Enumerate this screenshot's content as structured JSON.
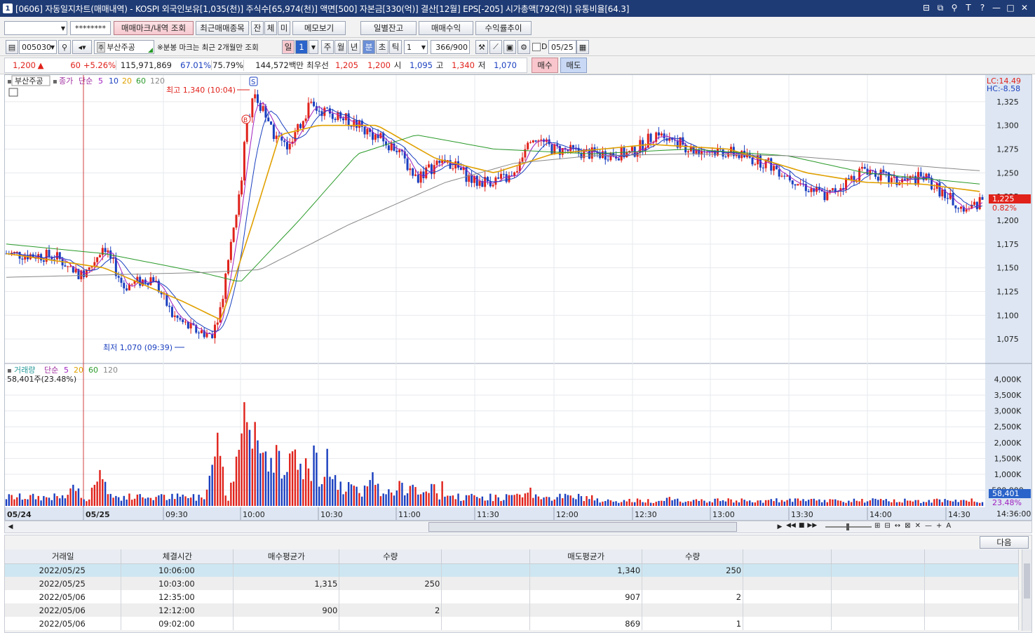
{
  "window": {
    "app_badge": "1",
    "title": "[0606] 자동일지차트(매매내역) - KOSPI 외국인보유[1,035(천)] 주식수[65,974(천)] 액면[500] 자본금[330(억)] 결산[12월] EPS[-205] 시가총액[792(억)] 유통비율[64.3]",
    "controls": [
      "⊟",
      "⧉",
      "⚲",
      "T",
      "?",
      "—",
      "□",
      "✕"
    ]
  },
  "toolbar1": {
    "account_value": "",
    "password_mask": "********",
    "buttons": [
      "매매마크/내역 조회",
      "최근매매종목",
      "잔",
      "체",
      "미",
      "메모보기"
    ],
    "buttons_right": [
      "일별잔고",
      "매매수익",
      "수익률추이"
    ]
  },
  "toolbar2": {
    "code": "005030",
    "stock_name": "부산주공",
    "note": "※분봉 마크는 최근 2개월만 조회",
    "period_tabs": [
      "일",
      "주",
      "월",
      "년",
      "분",
      "초",
      "틱"
    ],
    "day_count": "1",
    "interval": "1",
    "count_display": "366/900",
    "date_check_label": "D",
    "date": "05/25"
  },
  "quote": {
    "price": "1,200",
    "arrow": "▲",
    "change": "60",
    "change_pct": "+5.26%",
    "volume": "115,971,869",
    "rate1": "67.01%",
    "rate2": "75.79%",
    "amount": "144,572백만",
    "best_label": "최우선",
    "best_ask": "1,205",
    "best_bid": "1,200",
    "open_label": "시",
    "open": "1,095",
    "high_label": "고",
    "high": "1,340",
    "low_label": "저",
    "low": "1,070",
    "buy_label": "매수",
    "sell_label": "매도"
  },
  "chart_data": [
    {
      "type": "candlestick",
      "title": "부산주공",
      "legend": [
        "종가",
        "단순",
        "5",
        "10",
        "20",
        "60",
        "120"
      ],
      "legend_colors": {
        "close": "#a030a0",
        "ma5": "#a020c0",
        "ma10": "#1a3fbf",
        "ma20": "#e0a000",
        "ma60": "#2a9a2a",
        "ma120": "#888888"
      },
      "ylim": [
        1050,
        1350
      ],
      "y_ticks": [
        "1,325",
        "1,300",
        "1,275",
        "1,250",
        "1,225",
        "1,200",
        "1,175",
        "1,150",
        "1,125",
        "1,100",
        "1,075"
      ],
      "y_tick_values": [
        1325,
        1300,
        1275,
        1250,
        1225,
        1200,
        1175,
        1150,
        1125,
        1100,
        1075
      ],
      "x_ticks": [
        "05/24",
        "05/25",
        "09:30",
        "10:00",
        "10:30",
        "11:00",
        "11:30",
        "12:00",
        "12:30",
        "13:00",
        "13:30",
        "14:00",
        "14:30"
      ],
      "right_labels": {
        "lc": "LC:14.49",
        "hc": "HC:-8.58",
        "current": "1,225",
        "current_pct": "0.82%"
      },
      "annotations": {
        "high": "최고 1,340 (10:04)",
        "low": "최저 1,070 (09:39)",
        "sell_mark": "S",
        "buy_mark": "B"
      },
      "price_path": [
        {
          "t": 0,
          "v": 1165
        },
        {
          "t": 0.05,
          "v": 1162
        },
        {
          "t": 0.08,
          "v": 1140
        },
        {
          "t": 0.1,
          "v": 1175
        },
        {
          "t": 0.12,
          "v": 1130
        },
        {
          "t": 0.15,
          "v": 1140
        },
        {
          "t": 0.17,
          "v": 1100
        },
        {
          "t": 0.19,
          "v": 1085
        },
        {
          "t": 0.21,
          "v": 1080
        },
        {
          "t": 0.22,
          "v": 1110
        },
        {
          "t": 0.23,
          "v": 1180
        },
        {
          "t": 0.24,
          "v": 1230
        },
        {
          "t": 0.245,
          "v": 1300
        },
        {
          "t": 0.255,
          "v": 1335
        },
        {
          "t": 0.27,
          "v": 1295
        },
        {
          "t": 0.29,
          "v": 1275
        },
        {
          "t": 0.31,
          "v": 1320
        },
        {
          "t": 0.34,
          "v": 1310
        },
        {
          "t": 0.36,
          "v": 1300
        },
        {
          "t": 0.4,
          "v": 1275
        },
        {
          "t": 0.42,
          "v": 1245
        },
        {
          "t": 0.45,
          "v": 1265
        },
        {
          "t": 0.48,
          "v": 1240
        },
        {
          "t": 0.52,
          "v": 1245
        },
        {
          "t": 0.535,
          "v": 1290
        },
        {
          "t": 0.56,
          "v": 1275
        },
        {
          "t": 0.6,
          "v": 1270
        },
        {
          "t": 0.64,
          "v": 1270
        },
        {
          "t": 0.67,
          "v": 1295
        },
        {
          "t": 0.7,
          "v": 1275
        },
        {
          "t": 0.74,
          "v": 1272
        },
        {
          "t": 0.78,
          "v": 1260
        },
        {
          "t": 0.82,
          "v": 1235
        },
        {
          "t": 0.84,
          "v": 1225
        },
        {
          "t": 0.88,
          "v": 1255
        },
        {
          "t": 0.91,
          "v": 1240
        },
        {
          "t": 0.94,
          "v": 1245
        },
        {
          "t": 0.97,
          "v": 1220
        },
        {
          "t": 0.985,
          "v": 1208
        },
        {
          "t": 1.0,
          "v": 1222
        }
      ],
      "ma20_path": [
        {
          "t": 0,
          "v": 1165
        },
        {
          "t": 0.1,
          "v": 1150
        },
        {
          "t": 0.18,
          "v": 1115
        },
        {
          "t": 0.22,
          "v": 1095
        },
        {
          "t": 0.25,
          "v": 1190
        },
        {
          "t": 0.28,
          "v": 1290
        },
        {
          "t": 0.32,
          "v": 1300
        },
        {
          "t": 0.38,
          "v": 1300
        },
        {
          "t": 0.44,
          "v": 1265
        },
        {
          "t": 0.5,
          "v": 1250
        },
        {
          "t": 0.56,
          "v": 1270
        },
        {
          "t": 0.66,
          "v": 1280
        },
        {
          "t": 0.74,
          "v": 1275
        },
        {
          "t": 0.82,
          "v": 1250
        },
        {
          "t": 0.88,
          "v": 1240
        },
        {
          "t": 0.94,
          "v": 1238
        },
        {
          "t": 1.0,
          "v": 1230
        }
      ],
      "ma60_path": [
        {
          "t": 0,
          "v": 1175
        },
        {
          "t": 0.1,
          "v": 1165
        },
        {
          "t": 0.2,
          "v": 1145
        },
        {
          "t": 0.24,
          "v": 1135
        },
        {
          "t": 0.3,
          "v": 1200
        },
        {
          "t": 0.36,
          "v": 1270
        },
        {
          "t": 0.42,
          "v": 1290
        },
        {
          "t": 0.5,
          "v": 1275
        },
        {
          "t": 0.6,
          "v": 1270
        },
        {
          "t": 0.7,
          "v": 1275
        },
        {
          "t": 0.8,
          "v": 1268
        },
        {
          "t": 0.88,
          "v": 1250
        },
        {
          "t": 1.0,
          "v": 1238
        }
      ],
      "ma120_path": [
        {
          "t": 0,
          "v": 1140
        },
        {
          "t": 0.2,
          "v": 1145
        },
        {
          "t": 0.26,
          "v": 1148
        },
        {
          "t": 0.35,
          "v": 1195
        },
        {
          "t": 0.45,
          "v": 1240
        },
        {
          "t": 0.52,
          "v": 1260
        },
        {
          "t": 0.6,
          "v": 1268
        },
        {
          "t": 0.7,
          "v": 1270
        },
        {
          "t": 0.8,
          "v": 1268
        },
        {
          "t": 0.9,
          "v": 1260
        },
        {
          "t": 1.0,
          "v": 1252
        }
      ]
    },
    {
      "type": "bar",
      "title": "거래량",
      "legend": [
        "거래량",
        "단순",
        "5",
        "20",
        "60",
        "120"
      ],
      "current_volume_label": "58,401주(23.48%)",
      "ylim": [
        0,
        4300000
      ],
      "y_ticks": [
        "4,000K",
        "3,500K",
        "3,000K",
        "2,500K",
        "2,000K",
        "1,500K",
        "1,000K",
        "500,000"
      ],
      "y_tick_values": [
        4000000,
        3500000,
        3000000,
        2500000,
        2000000,
        1500000,
        1000000,
        500000
      ],
      "right_labels": {
        "current": "58,401",
        "pct": "23.48%"
      },
      "spikes": [
        {
          "t": 0.07,
          "v": 900000
        },
        {
          "t": 0.095,
          "v": 1700000
        },
        {
          "t": 0.215,
          "v": 3000000
        },
        {
          "t": 0.24,
          "v": 2700000
        },
        {
          "t": 0.245,
          "v": 4200000
        },
        {
          "t": 0.255,
          "v": 3900000
        },
        {
          "t": 0.27,
          "v": 2100000
        },
        {
          "t": 0.29,
          "v": 1900000
        },
        {
          "t": 0.31,
          "v": 1500000
        },
        {
          "t": 0.335,
          "v": 1500000
        },
        {
          "t": 0.375,
          "v": 1200000
        },
        {
          "t": 0.415,
          "v": 1000000
        },
        {
          "t": 0.535,
          "v": 700000
        },
        {
          "t": 0.68,
          "v": 700000
        },
        {
          "t": 0.97,
          "v": 300000
        }
      ]
    }
  ],
  "scroll": {
    "nav": [
      "◀◀",
      "■",
      "▶▶"
    ],
    "zoom_icons": [
      "⊞",
      "⊟",
      "↔",
      "⊠",
      "✕",
      "—",
      "+",
      "A"
    ]
  },
  "grid": {
    "next_label": "다음",
    "headers": [
      "거래일",
      "체결시간",
      "매수평균가",
      "수량",
      "",
      "매도평균가",
      "수량",
      "",
      "",
      ""
    ],
    "rows": [
      {
        "date": "2022/05/25",
        "time": "10:06:00",
        "buy_price": "",
        "buy_qty": "",
        "sell_price": "1,340",
        "sell_qty": "250"
      },
      {
        "date": "2022/05/25",
        "time": "10:03:00",
        "buy_price": "1,315",
        "buy_qty": "250",
        "sell_price": "",
        "sell_qty": ""
      },
      {
        "date": "2022/05/06",
        "time": "12:35:00",
        "buy_price": "",
        "buy_qty": "",
        "sell_price": "907",
        "sell_qty": "2"
      },
      {
        "date": "2022/05/06",
        "time": "12:12:00",
        "buy_price": "900",
        "buy_qty": "2",
        "sell_price": "",
        "sell_qty": ""
      },
      {
        "date": "2022/05/06",
        "time": "09:02:00",
        "buy_price": "",
        "buy_qty": "",
        "sell_price": "869",
        "sell_qty": "1"
      }
    ]
  }
}
